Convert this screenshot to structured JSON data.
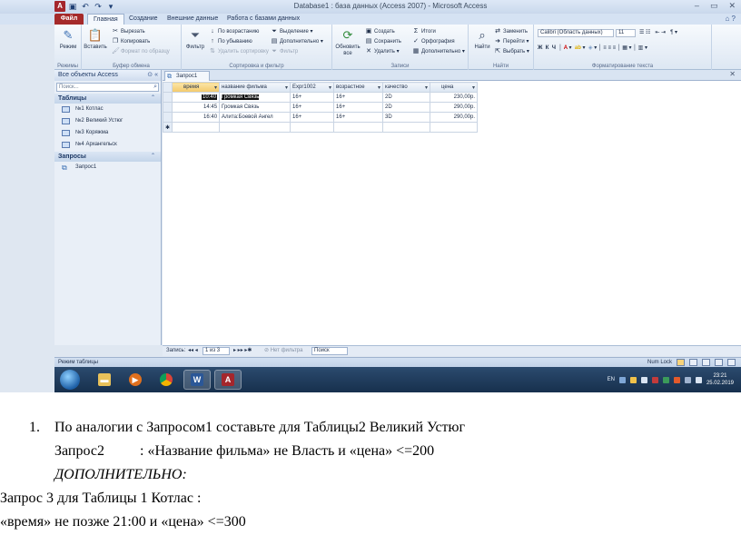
{
  "window": {
    "title": "Database1 : база данных (Access 2007) - Microsoft Access",
    "app_icon": "A",
    "qat": [
      "save-icon",
      "undo-icon",
      "redo-icon"
    ],
    "controls": [
      "–",
      "▭",
      "✕"
    ]
  },
  "tabs": [
    {
      "label": "Файл"
    },
    {
      "label": "Главная"
    },
    {
      "label": "Создание"
    },
    {
      "label": "Внешние данные"
    },
    {
      "label": "Работа с базами данных"
    }
  ],
  "ribbon": {
    "views": {
      "view_label": "Режим",
      "group": "Режимы"
    },
    "clipboard": {
      "paste": "Вставить",
      "cut": "Вырезать",
      "copy": "Копировать",
      "format": "Формат по образцу",
      "group": "Буфер обмена"
    },
    "sort": {
      "filter": "Фильтр",
      "asc": "По возрастанию",
      "desc": "По убыванию",
      "remove": "Удалить сортировку",
      "selection": "Выделение",
      "advanced": "Дополнительно",
      "toggle": "Фильтр",
      "group": "Сортировка и фильтр"
    },
    "records": {
      "refresh": "Обновить все",
      "new": "Создать",
      "save": "Сохранить",
      "delete": "Удалить",
      "totals": "Итоги",
      "spelling": "Орфография",
      "more": "Дополнительно",
      "group": "Записи"
    },
    "find": {
      "find": "Найти",
      "replace": "Заменить",
      "goto": "Перейти",
      "select": "Выбрать",
      "group": "Найти"
    },
    "text": {
      "font": "Calibri (Область данных)",
      "size": "11",
      "group": "Форматирование текста"
    }
  },
  "nav": {
    "header": "Все объекты Access",
    "search_placeholder": "Поиск...",
    "tables_label": "Таблицы",
    "tables": [
      "№1 Котлас",
      "№2 Великий Устюг",
      "№3 Коряжма",
      "№4 Архангельск"
    ],
    "queries_label": "Запросы",
    "queries": [
      "Запрос1"
    ]
  },
  "doc": {
    "tab": "Запрос1",
    "columns": [
      "время",
      "название фильма",
      "Expr1002",
      "возрастное",
      "качество",
      "цена"
    ],
    "rows": [
      [
        "10:40",
        "Громкая Связь",
        "16+",
        "16+",
        "2D",
        "230,00р."
      ],
      [
        "14:45",
        "Громкая Связь",
        "16+",
        "16+",
        "2D",
        "290,00р."
      ],
      [
        "16:40",
        "Алита:Боевой Ангел",
        "16+",
        "16+",
        "3D",
        "290,00р."
      ]
    ],
    "new_row_marker": "✱"
  },
  "recnav": {
    "label": "Запись:",
    "position": "1 из 3",
    "filter": "Нет фильтра",
    "search": "Поиск"
  },
  "status": {
    "left": "Режим таблицы",
    "numlock": "Num Lock"
  },
  "taskbar": {
    "apps": [
      "explorer",
      "media-player",
      "chrome",
      "word",
      "access"
    ],
    "lang": "EN",
    "time": "23:21",
    "date": "25.02.2019"
  },
  "task": {
    "number": "1.",
    "line1": "По аналогии с Запросом1 составьте для Таблицы2 Великий Устюг",
    "line2a": "Запрос2",
    "line2b": ": «Название фильма» не Власть и «цена» <=200",
    "line3": "ДОПОЛНИТЕЛЬНО:",
    "line4": "Запрос 3 для Таблицы 1 Котлас :",
    "line5": "«время» не позже 21:00 и «цена» <=300"
  }
}
